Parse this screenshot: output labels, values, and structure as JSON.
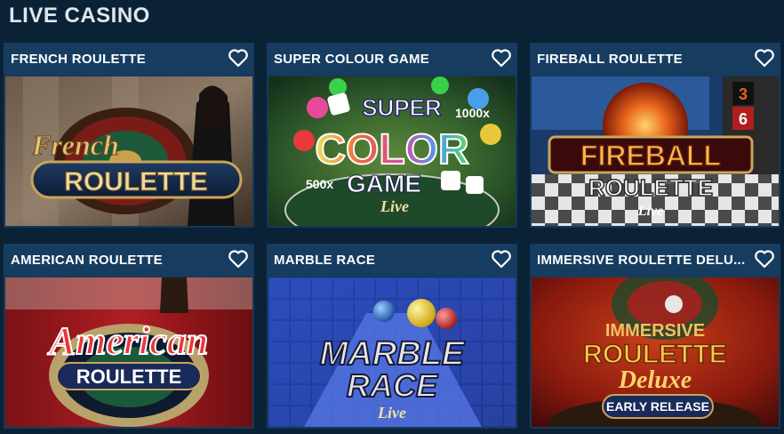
{
  "page": {
    "title": "LIVE CASINO"
  },
  "games": [
    {
      "title": "FRENCH ROULETTE",
      "art_script": "French",
      "art_main": "ROULETTE"
    },
    {
      "title": "SUPER COLOUR GAME",
      "art_top": "SUPER",
      "art_mid": "COLOR",
      "art_bottom": "GAME",
      "art_mult_a": "1000x",
      "art_mult_b": "500x",
      "art_live": "Live"
    },
    {
      "title": "FIREBALL ROULETTE",
      "art_top": "FIREBALL",
      "art_main": "ROULETTE",
      "art_live": "Live",
      "art_num_a": "3",
      "art_num_b": "6"
    },
    {
      "title": "AMERICAN ROULETTE",
      "art_script": "American",
      "art_main": "ROULETTE"
    },
    {
      "title": "MARBLE RACE",
      "art_top": "MARBLE",
      "art_main": "RACE",
      "art_live": "Live"
    },
    {
      "title": "IMMERSIVE ROULETTE DELU...",
      "art_top": "IMMERSIVE",
      "art_main": "ROULETTE",
      "art_script": "Deluxe",
      "art_badge": "EARLY RELEASE"
    }
  ],
  "icons": {
    "favorite": "heart-outline-icon"
  },
  "colors": {
    "background": "#0b2236",
    "card_header": "#163d60",
    "title_text": "#dfe6ee"
  }
}
